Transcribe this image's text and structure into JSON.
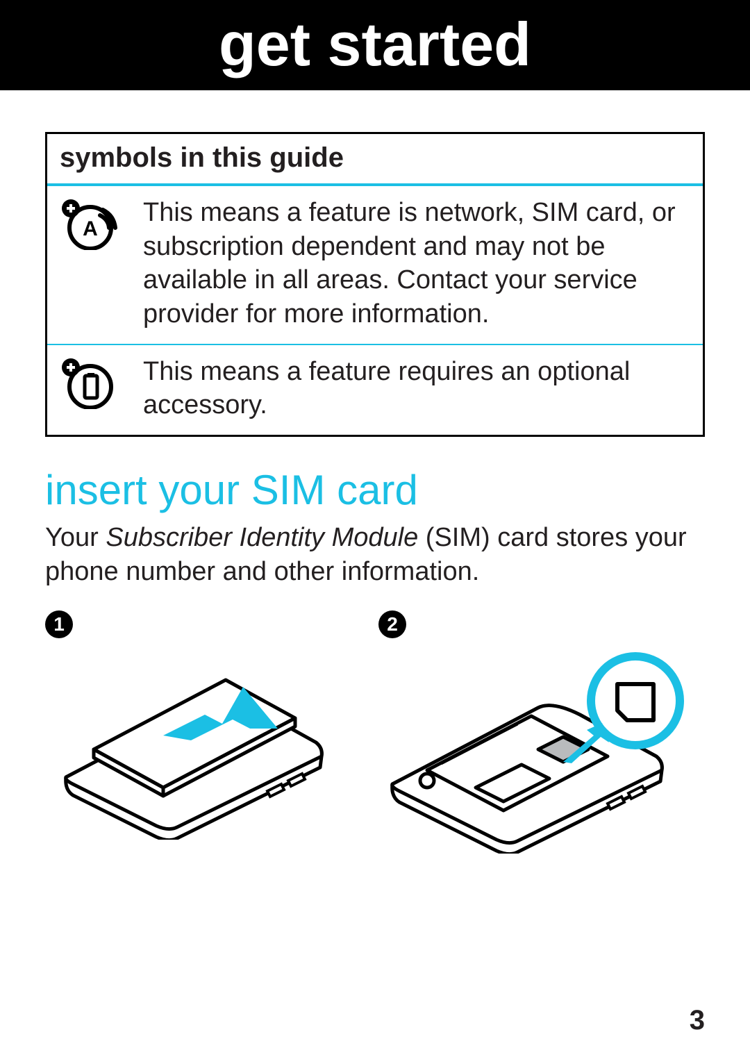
{
  "header": {
    "title": "get started"
  },
  "symbols_box": {
    "title": "symbols in this guide",
    "rows": [
      {
        "icon_name": "network-dependent-icon",
        "text": "This means a feature is network, SIM card, or subscription dependent and may not be available in all areas. Contact your service provider for more information."
      },
      {
        "icon_name": "optional-accessory-icon",
        "text": "This means a feature requires an optional accessory."
      }
    ]
  },
  "section": {
    "heading": "insert your SIM card",
    "paragraph_prefix": "Your ",
    "paragraph_em": "Subscriber Identity Module",
    "paragraph_suffix": " (SIM) card stores your phone number and other information."
  },
  "steps": [
    {
      "num": "1",
      "caption": "remove-back-cover-illustration"
    },
    {
      "num": "2",
      "caption": "insert-sim-illustration"
    }
  ],
  "page_number": "3",
  "colors": {
    "accent": "#1bbfe4"
  }
}
